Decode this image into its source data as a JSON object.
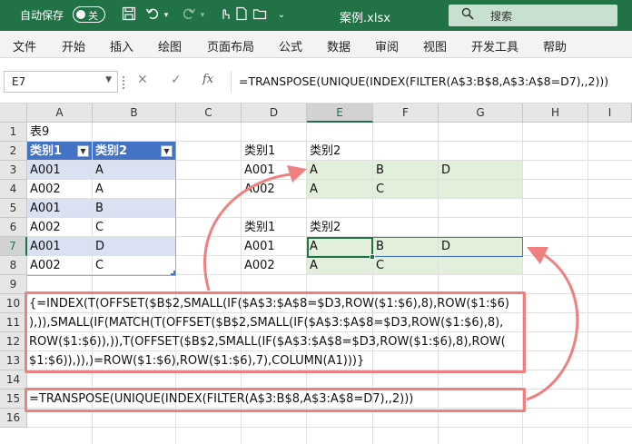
{
  "titlebar": {
    "autosave_label": "自动保存",
    "autosave_state": "关",
    "filename": "案例.xlsx",
    "search_placeholder": "搜索",
    "icons": [
      "save-icon",
      "undo-icon",
      "redo-icon",
      "touch-mode-icon",
      "new-file-icon",
      "customize-icon"
    ]
  },
  "menu": {
    "items": [
      "文件",
      "开始",
      "插入",
      "绘图",
      "页面布局",
      "公式",
      "数据",
      "审阅",
      "视图",
      "开发工具",
      "帮助"
    ]
  },
  "formula_bar": {
    "name_box": "E7",
    "cancel_glyph": "✕",
    "enter_glyph": "✓",
    "fx_glyph": "fx",
    "formula": "=TRANSPOSE(UNIQUE(INDEX(FILTER(A$3:B$8,A$3:A$8=D7),,2)))"
  },
  "grid": {
    "columns": [
      "A",
      "B",
      "C",
      "D",
      "E",
      "F",
      "G",
      "H",
      "I"
    ],
    "selected_column": "E",
    "rows": [
      "1",
      "2",
      "3",
      "4",
      "5",
      "6",
      "7",
      "8",
      "9",
      "10",
      "11",
      "12",
      "13",
      "14",
      "15",
      "16"
    ],
    "selected_row": "7"
  },
  "table": {
    "caption": "表9",
    "headers": [
      "类别1",
      "类别2"
    ],
    "rows": [
      [
        "A001",
        "A"
      ],
      [
        "A002",
        "A"
      ],
      [
        "A001",
        "B"
      ],
      [
        "A002",
        "C"
      ],
      [
        "A001",
        "D"
      ],
      [
        "A002",
        "C"
      ]
    ]
  },
  "result_top": {
    "headers": [
      "类别1",
      "类别2"
    ],
    "rows": [
      {
        "key": "A001",
        "values": [
          "A",
          "B",
          "D"
        ]
      },
      {
        "key": "A002",
        "values": [
          "A",
          "C"
        ]
      }
    ]
  },
  "result_bottom": {
    "headers": [
      "类别1",
      "类别2"
    ],
    "rows": [
      {
        "key": "A001",
        "values": [
          "A",
          "B",
          "D"
        ]
      },
      {
        "key": "A002",
        "values": [
          "A",
          "C"
        ]
      }
    ]
  },
  "formulas": {
    "legacy_lines": [
      "{=INDEX(T(OFFSET($B$2,SMALL(IF($A$3:$A$8=$D3,ROW($1:$6),8),ROW($1:$6)",
      "),)),SMALL(IF(MATCH(T(OFFSET($B$2,SMALL(IF($A$3:$A$8=$D3,ROW($1:$6),8),",
      "ROW($1:$6)),)),T(OFFSET($B$2,SMALL(IF($A$3:$A$8=$D3,ROW($1:$6),8),ROW(",
      "$1:$6)),)),)=ROW($1:$6),ROW($1:$6),7),COLUMN(A1)))}"
    ],
    "modern": "=TRANSPOSE(UNIQUE(INDEX(FILTER(A$3:B$8,A$3:A$8=D7),,2)))"
  },
  "colors": {
    "title_bar": "#217346",
    "table_header": "#4472c4",
    "table_band": "#d9e1f2",
    "result_fill": "#e2efda",
    "annotation": "#f08080"
  }
}
